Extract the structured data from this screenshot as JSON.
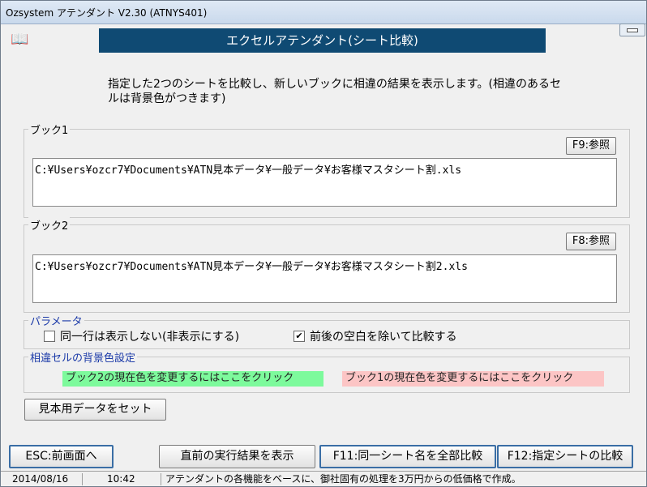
{
  "window": {
    "title": "Ozsystem アテンダント V2.30 (ATNYS401)"
  },
  "header": {
    "banner": "エクセルアテンダント(シート比較)",
    "description": "指定した2つのシートを比較し、新しいブックに相違の結果を表示します。(相違のあるセルは背景色がつきます)"
  },
  "book1": {
    "label": "ブック1",
    "browse_label": "F9:参照",
    "path": "C:¥Users¥ozcr7¥Documents¥ATN見本データ¥一般データ¥お客様マスタシート割.xls"
  },
  "book2": {
    "label": "ブック2",
    "browse_label": "F8:参照",
    "path": "C:¥Users¥ozcr7¥Documents¥ATN見本データ¥一般データ¥お客様マスタシート割2.xls"
  },
  "parameters": {
    "label": "パラメータ",
    "option1": {
      "label": "同一行は表示しない(非表示にする)",
      "checked": false
    },
    "option2": {
      "label": "前後の空白を除いて比較する",
      "checked": true
    }
  },
  "bgcolor": {
    "label": "相違セルの背景色設定",
    "book2_text": "ブック2の現在色を変更するにはここをクリック",
    "book2_color": "#7dfa9c",
    "book1_text": "ブック1の現在色を変更するにはここをクリック",
    "book1_color": "#fcc5c5"
  },
  "buttons": {
    "sample": "見本用データをセット",
    "esc": "ESC:前画面へ",
    "last_result": "直前の実行結果を表示",
    "f11": "F11:同一シート名を全部比較",
    "f12": "F12:指定シートの比較"
  },
  "status": {
    "date": "2014/08/16",
    "time": "10:42",
    "message": "アテンダントの各機能をベースに、御社固有の処理を3万円からの低価格で作成。"
  }
}
